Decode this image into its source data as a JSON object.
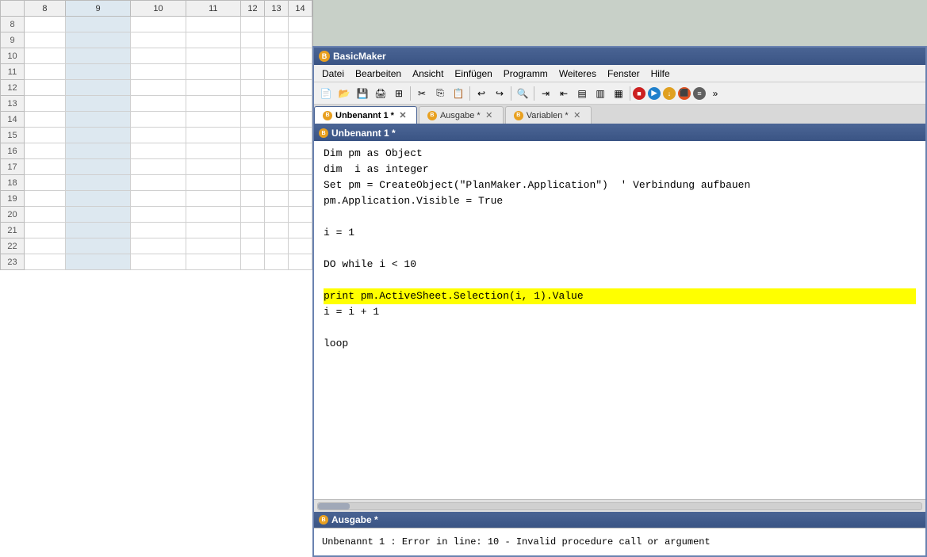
{
  "spreadsheet": {
    "col_headers": [
      "",
      "8",
      "9",
      "10",
      "11",
      "12",
      "13",
      "14"
    ],
    "rows": [
      {
        "num": "8"
      },
      {
        "num": "9"
      },
      {
        "num": "10"
      },
      {
        "num": "11"
      },
      {
        "num": "12"
      },
      {
        "num": "13"
      },
      {
        "num": "14"
      },
      {
        "num": "15"
      },
      {
        "num": "16"
      },
      {
        "num": "17"
      },
      {
        "num": "18"
      },
      {
        "num": "19"
      },
      {
        "num": "20"
      },
      {
        "num": "21"
      },
      {
        "num": "22"
      },
      {
        "num": "23"
      }
    ]
  },
  "app": {
    "title": "BasicMaker",
    "menus": [
      "Datei",
      "Bearbeiten",
      "Ansicht",
      "Einfügen",
      "Programm",
      "Weiteres",
      "Fenster",
      "Hilfe"
    ]
  },
  "tabs": [
    {
      "label": "Unbenannt 1 *",
      "active": true
    },
    {
      "label": "Ausgabe *",
      "active": false
    },
    {
      "label": "Variablen *",
      "active": false
    }
  ],
  "doc_title": "Unbenannt 1 *",
  "code": {
    "lines": [
      {
        "text": "Dim pm as Object",
        "highlighted": false
      },
      {
        "text": "dim  i as integer",
        "highlighted": false
      },
      {
        "text": "Set pm = CreateObject(\"PlanMaker.Application\")  ' Verbindung aufbauen",
        "highlighted": false
      },
      {
        "text": "pm.Application.Visible = True",
        "highlighted": false
      },
      {
        "text": "",
        "highlighted": false
      },
      {
        "text": "i = 1",
        "highlighted": false
      },
      {
        "text": "",
        "highlighted": false
      },
      {
        "text": "DO while i < 10",
        "highlighted": false
      },
      {
        "text": "",
        "highlighted": false
      },
      {
        "text": "print pm.ActiveSheet.Selection(i, 1).Value",
        "highlighted": true
      },
      {
        "text": "i = i + 1",
        "highlighted": false
      },
      {
        "text": "",
        "highlighted": false
      },
      {
        "text": "loop",
        "highlighted": false
      }
    ]
  },
  "output": {
    "title": "Ausgabe *",
    "text": "Unbenannt 1 : Error in line: 10 - Invalid procedure call or argument"
  }
}
